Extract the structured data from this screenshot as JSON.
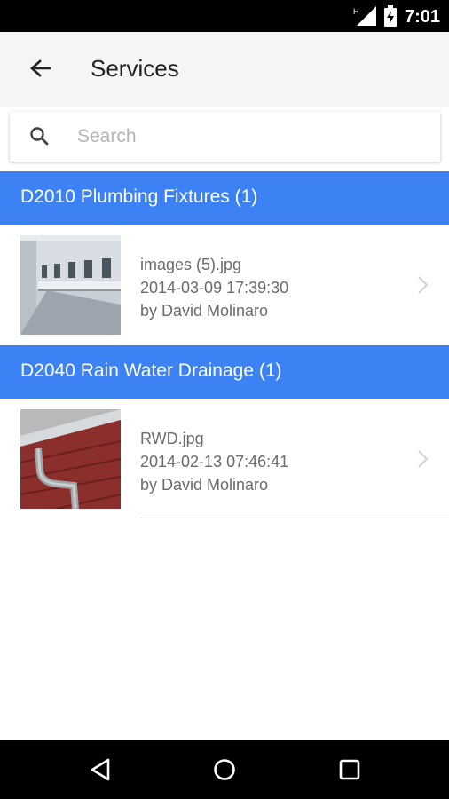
{
  "status_bar": {
    "time": "7:01",
    "network_badge": "H",
    "signal_icon": "signal-icon",
    "battery_icon": "battery-charging-icon"
  },
  "app_bar": {
    "title": "Services",
    "back_icon": "arrow-back-icon"
  },
  "search": {
    "placeholder": "Search",
    "value": "",
    "icon": "search-icon"
  },
  "sections": [
    {
      "header": "D2010 Plumbing Fixtures (1)",
      "items": [
        {
          "filename": "images (5).jpg",
          "timestamp": "2014-03-09 17:39:30",
          "author": "by David Molinaro",
          "thumbnail": "restroom-sinks-photo"
        }
      ]
    },
    {
      "header": "D2040 Rain Water Drainage (1)",
      "items": [
        {
          "filename": "RWD.jpg",
          "timestamp": "2014-02-13 07:46:41",
          "author": "by David Molinaro",
          "thumbnail": "downspout-photo"
        }
      ]
    }
  ],
  "nav_bar": {
    "back_icon": "nav-back-icon",
    "home_icon": "nav-home-icon",
    "recents_icon": "nav-recents-icon"
  },
  "colors": {
    "accent": "#3d82f5",
    "app_bar_bg": "#f5f5f5",
    "secondary_text": "#6b6b6b"
  }
}
